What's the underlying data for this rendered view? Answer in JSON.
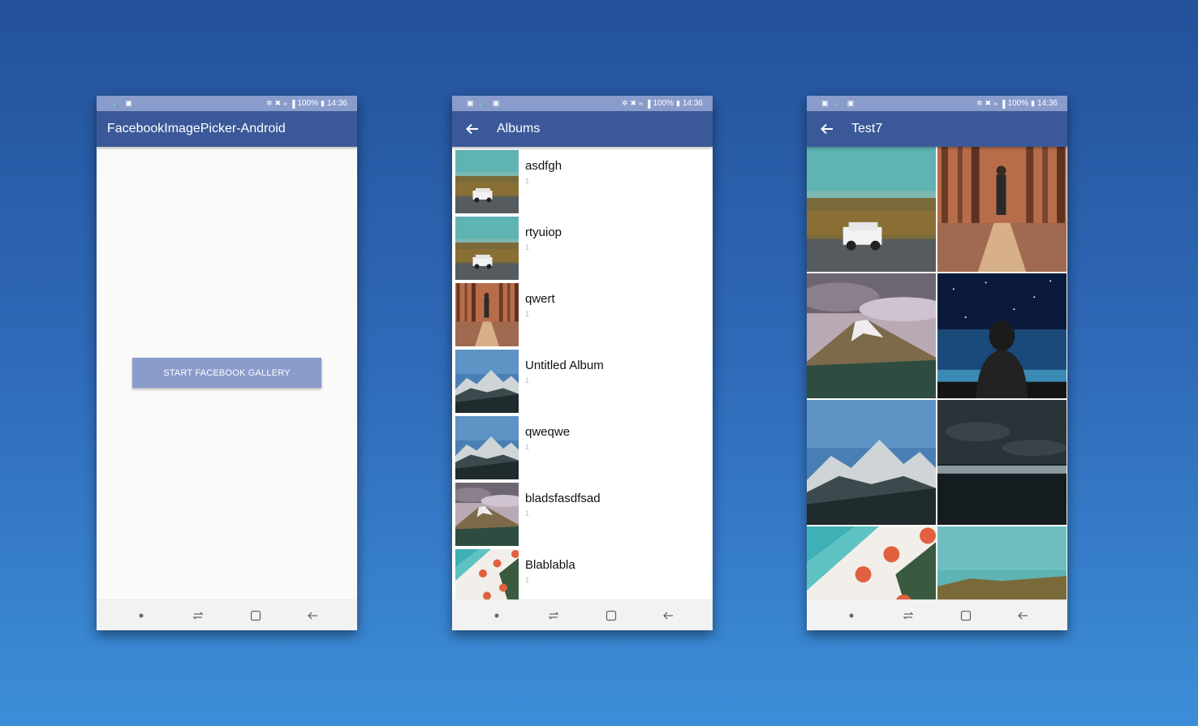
{
  "status_bar": {
    "battery": "100%",
    "time": "14:36"
  },
  "screen1": {
    "title": "FacebookImagePicker-Android",
    "button_label": "START FACEBOOK GALLERY"
  },
  "screen2": {
    "title": "Albums",
    "albums": [
      {
        "name": "asdfgh",
        "count": "1",
        "thumb": "jeep-landscape"
      },
      {
        "name": "rtyuiop",
        "count": "1",
        "thumb": "jeep-landscape"
      },
      {
        "name": "qwert",
        "count": "1",
        "thumb": "forest-person"
      },
      {
        "name": "Untitled Album",
        "count": "1",
        "thumb": "snowy-mountains"
      },
      {
        "name": "qweqwe",
        "count": "1",
        "thumb": "snowy-mountains"
      },
      {
        "name": "bladsfasdfsad",
        "count": "1",
        "thumb": "volcano-mountain"
      },
      {
        "name": "Blablabla",
        "count": "1",
        "thumb": "beach-umbrellas"
      }
    ]
  },
  "screen3": {
    "title": "Test7",
    "photos": [
      "jeep-landscape",
      "forest-person",
      "volcano-mountain",
      "night-sky-person",
      "snowy-mountains",
      "dark-ocean",
      "beach-umbrellas",
      "coastline"
    ]
  },
  "colors": {
    "toolbar": "#3b5998",
    "statusbar": "#8a9ccb",
    "button": "#8a9ccb"
  }
}
